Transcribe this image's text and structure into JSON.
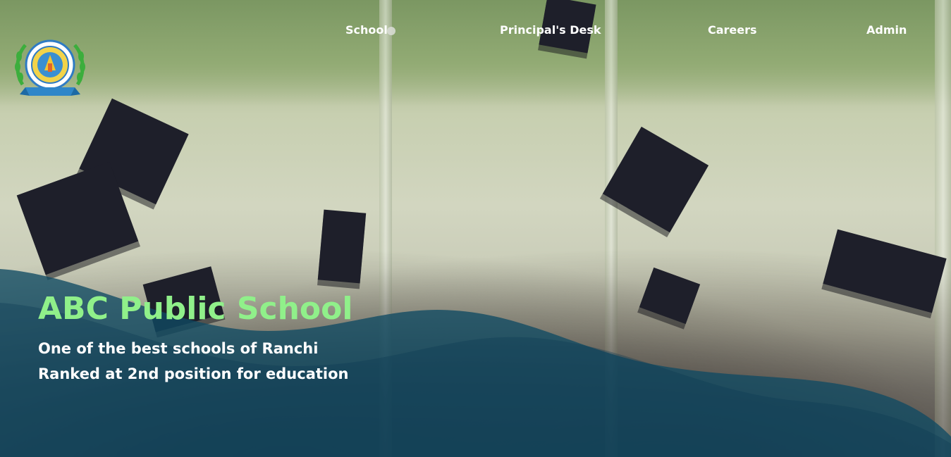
{
  "nav": {
    "items": [
      {
        "label": "School"
      },
      {
        "label": "Principal's Desk"
      },
      {
        "label": "Careers"
      },
      {
        "label": "Admin"
      }
    ]
  },
  "hero": {
    "title": "ABC Public School",
    "lines": [
      "One of the best schools of Ranchi",
      "Ranked at 2nd position for education"
    ]
  },
  "logo": {
    "icon": "school-crest-logo"
  },
  "colors": {
    "title": "#90f08a",
    "wave": "#0f4a63",
    "nav_text": "#ffffff"
  }
}
